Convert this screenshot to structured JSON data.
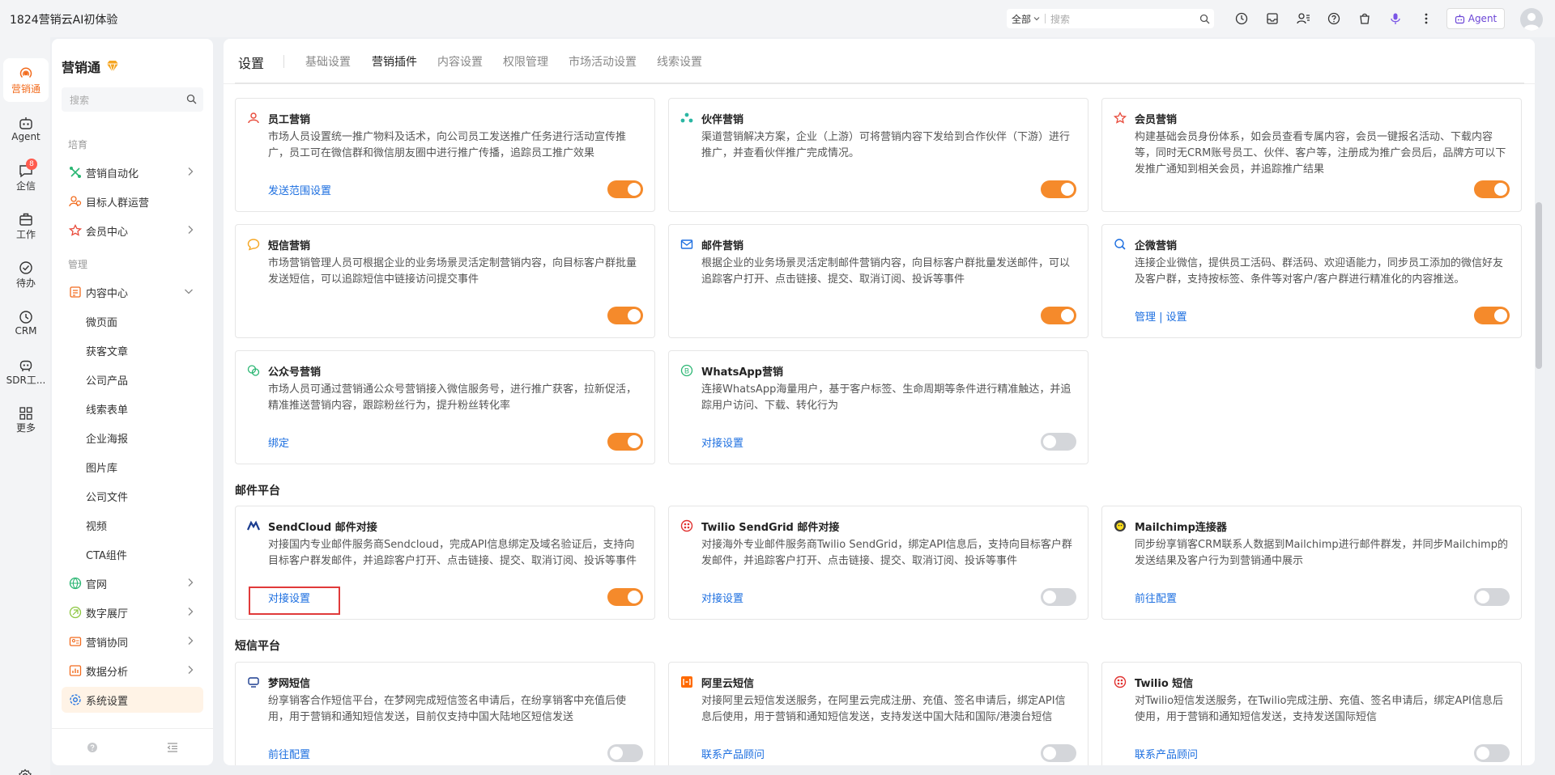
{
  "app": {
    "title": "1824营销云AI初体验"
  },
  "topbar": {
    "search_scope": "全部",
    "search_placeholder": "搜索",
    "agent_label": "Agent"
  },
  "rail": {
    "items": [
      {
        "label": "营销通"
      },
      {
        "label": "Agent"
      },
      {
        "label": "企信",
        "badge": "8"
      },
      {
        "label": "工作"
      },
      {
        "label": "待办"
      },
      {
        "label": "CRM"
      },
      {
        "label": "SDR工..."
      },
      {
        "label": "更多"
      }
    ]
  },
  "sidebar": {
    "title": "营销通",
    "search_placeholder": "搜索",
    "group_cultivate": "培育",
    "group_manage": "管理",
    "items": [
      {
        "label": "营销自动化"
      },
      {
        "label": "目标人群运营"
      },
      {
        "label": "会员中心"
      },
      {
        "label": "内容中心"
      },
      {
        "label": "官网"
      },
      {
        "label": "数字展厅"
      },
      {
        "label": "营销协同"
      },
      {
        "label": "数据分析"
      },
      {
        "label": "系统设置"
      }
    ],
    "content_sub": [
      "微页面",
      "获客文章",
      "公司产品",
      "线索表单",
      "企业海报",
      "图片库",
      "公司文件",
      "视频",
      "CTA组件"
    ]
  },
  "tabs": {
    "title": "设置",
    "items": [
      "基础设置",
      "营销插件",
      "内容设置",
      "权限管理",
      "市场活动设置",
      "线索设置"
    ]
  },
  "colors": {
    "accent": "#f58a2b",
    "link": "#1d6fe0",
    "highlight": "#e03a3a"
  },
  "plugins": [
    {
      "title": "员工营销",
      "desc": "市场人员设置统一推广物料及话术，向公司员工发送推广任务进行活动宣传推广，员工可在微信群和微信朋友圈中进行推广传播，追踪员工推广效果",
      "link": "发送范围设置",
      "on": true,
      "icon": "employee-icon"
    },
    {
      "title": "伙伴营销",
      "desc": "渠道营销解决方案，企业（上游）可将营销内容下发给到合作伙伴（下游）进行推广，并查看伙伴推广完成情况。",
      "link": "",
      "on": true,
      "icon": "partner-icon"
    },
    {
      "title": "会员营销",
      "desc": "构建基础会员身份体系，如会员查看专属内容，会员一键报名活动、下载内容等，同时无CRM账号员工、伙伴、客户等，注册成为推广会员后，品牌方可以下发推广通知到相关会员，并追踪推广结果",
      "link": "",
      "on": true,
      "icon": "member-icon"
    },
    {
      "title": "短信营销",
      "desc": "市场营销管理人员可根据企业的业务场景灵活定制营销内容，向目标客户群批量发送短信，可以追踪短信中链接访问提交事件",
      "link": "",
      "on": true,
      "icon": "sms-icon"
    },
    {
      "title": "邮件营销",
      "desc": "根据企业的业务场景灵活定制邮件营销内容，向目标客户群批量发送邮件，可以追踪客户打开、点击链接、提交、取消订阅、投诉等事件",
      "link": "",
      "on": true,
      "icon": "mail-icon"
    },
    {
      "title": "企微营销",
      "desc": "连接企业微信，提供员工活码、群活码、欢迎语能力，同步员工添加的微信好友及客户群，支持按标签、条件等对客户/客户群进行精准化的内容推送。",
      "link": "管理 | 设置",
      "on": true,
      "icon": "wecom-icon"
    },
    {
      "title": "公众号营销",
      "desc": "市场人员可通过营销通公众号营销接入微信服务号，进行推广获客，拉新促活，精准推送营销内容，跟踪粉丝行为，提升粉丝转化率",
      "link": "绑定",
      "on": true,
      "icon": "official-account-icon"
    },
    {
      "title": "WhatsApp营销",
      "desc": "连接WhatsApp海量用户，基于客户标签、生命周期等条件进行精准触达，并追踪用户访问、下载、转化行为",
      "link": "对接设置",
      "on": false,
      "icon": "whatsapp-icon"
    }
  ],
  "mail_section": {
    "title": "邮件平台",
    "items": [
      {
        "title": "SendCloud 邮件对接",
        "desc": "对接国内专业邮件服务商Sendcloud，完成API信息绑定及域名验证后，支持向目标客户群发邮件，并追踪客户打开、点击链接、提交、取消订阅、投诉等事件",
        "link": "对接设置",
        "on": true,
        "icon": "sendcloud-icon"
      },
      {
        "title": "Twilio SendGrid 邮件对接",
        "desc": "对接海外专业邮件服务商Twilio SendGrid，绑定API信息后，支持向目标客户群发邮件，并追踪客户打开、点击链接、提交、取消订阅、投诉等事件",
        "link": "对接设置",
        "on": false,
        "icon": "twilio-icon"
      },
      {
        "title": "Mailchimp连接器",
        "desc": "同步纷享销客CRM联系人数据到Mailchimp进行邮件群发，并同步Mailchimp的发送结果及客户行为到营销通中展示",
        "link": "前往配置",
        "on": false,
        "icon": "mailchimp-icon"
      }
    ]
  },
  "sms_section": {
    "title": "短信平台",
    "items": [
      {
        "title": "梦网短信",
        "desc": "纷享销客合作短信平台，在梦网完成短信签名申请后，在纷享销客中充值后使用，用于营销和通知短信发送，目前仅支持中国大陆地区短信发送",
        "link": "前往配置",
        "on": false,
        "icon": "montnets-icon"
      },
      {
        "title": "阿里云短信",
        "desc": "对接阿里云短信发送服务，在阿里云完成注册、充值、签名申请后，绑定API信息后使用，用于营销和通知短信发送，支持发送中国大陆和国际/港澳台短信",
        "link": "联系产品顾问",
        "on": false,
        "icon": "aliyun-icon"
      },
      {
        "title": "Twilio 短信",
        "desc": "对Twilio短信发送服务，在Twilio完成注册、充值、签名申请后，绑定API信息后使用，用于营销和通知短信发送，支持发送国际短信",
        "link": "联系产品顾问",
        "on": false,
        "icon": "twilio-icon"
      }
    ]
  }
}
